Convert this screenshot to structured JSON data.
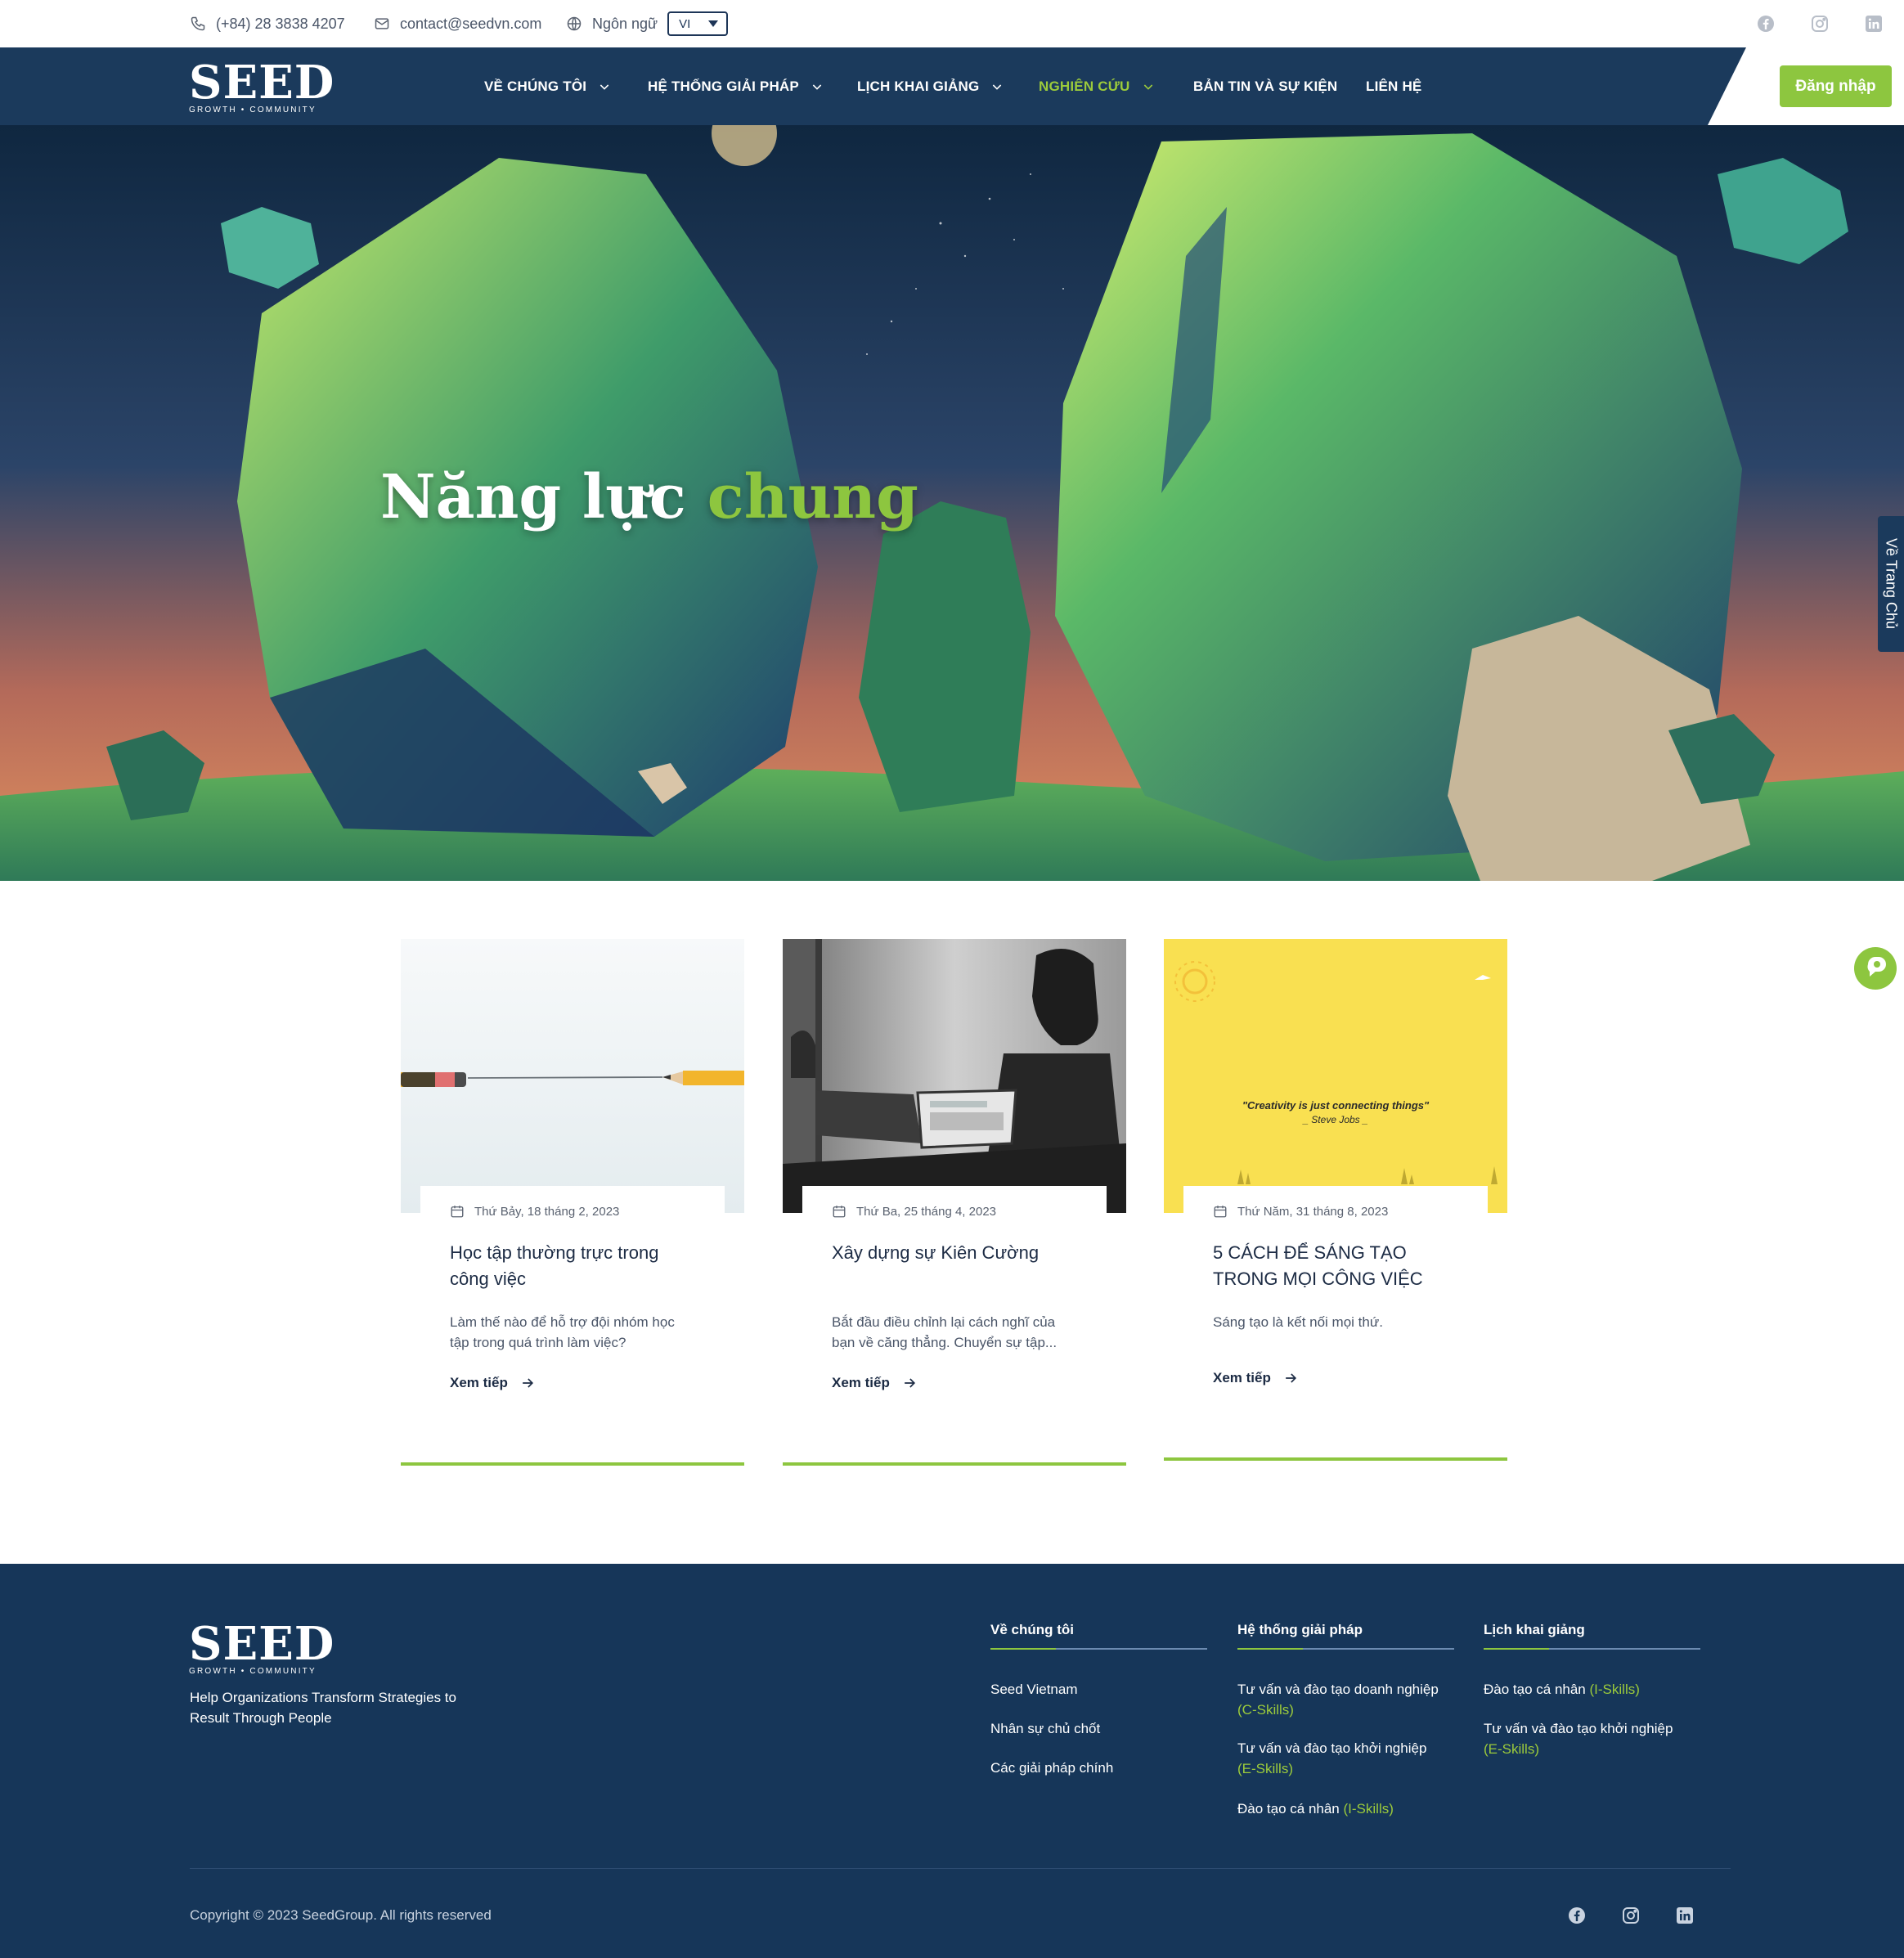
{
  "topbar": {
    "phone": "(+84) 28 3838 4207",
    "email": "contact@seedvn.com",
    "language_label": "Ngôn ngữ",
    "language_value": "VI",
    "social": [
      "facebook-icon",
      "instagram-icon",
      "linkedin-icon"
    ]
  },
  "brand": {
    "name": "SEED",
    "tagline": "GROWTH • COMMUNITY"
  },
  "nav": {
    "items": [
      {
        "label": "VỀ CHÚNG TÔI",
        "has_dropdown": true
      },
      {
        "label": "HỆ THỐNG GIẢI PHÁP",
        "has_dropdown": true
      },
      {
        "label": "LỊCH KHAI GIẢNG",
        "has_dropdown": true
      },
      {
        "label": "NGHIÊN CỨU",
        "has_dropdown": true,
        "active": true
      },
      {
        "label": "BẢN TIN VÀ SỰ KIỆN",
        "has_dropdown": false
      },
      {
        "label": "LIÊN HỆ",
        "has_dropdown": false
      }
    ],
    "login_label": "Đăng nhập"
  },
  "hero": {
    "title_part1": "Năng lực",
    "title_part2": "chung",
    "side_tab": "Về Trang Chủ"
  },
  "articles": [
    {
      "date": "Thứ Bảy, 18 tháng 2, 2023",
      "title": "Học tập thường trực trong công việc",
      "excerpt": "Làm thế nào để hỗ trợ đội nhóm học tập trong quá trình làm việc?",
      "read_more": "Xem tiếp"
    },
    {
      "date": "Thứ Ba, 25 tháng 4, 2023",
      "title": "Xây dựng sự Kiên Cường",
      "excerpt": "Bắt đầu điều chỉnh lại cách nghĩ của bạn về căng thẳng. Chuyển sự tập...",
      "read_more": "Xem tiếp"
    },
    {
      "date": "Thứ Năm, 31 tháng 8, 2023",
      "title": "5 CÁCH ĐỂ SÁNG TẠO TRONG MỌI CÔNG VIỆC",
      "excerpt": "Sáng tạo là kết nối mọi thứ.",
      "read_more": "Xem tiếp",
      "image_quote": "\"Creativity is just connecting things\"",
      "image_quote_author": "_ Steve Jobs _"
    }
  ],
  "footer": {
    "tagline": "Help Organizations Transform Strategies to Result Through People",
    "columns": [
      {
        "heading": "Về chúng tôi",
        "links": [
          {
            "text": "Seed Vietnam",
            "tag": ""
          },
          {
            "text": "Nhân sự chủ chốt",
            "tag": ""
          },
          {
            "text": "Các giải pháp chính",
            "tag": ""
          }
        ]
      },
      {
        "heading": "Hệ thống giải pháp",
        "links": [
          {
            "text": "Tư vấn và đào tạo doanh nghiệp",
            "tag": "(C-Skills)"
          },
          {
            "text": "Tư vấn và đào tạo khởi nghiệp",
            "tag": "(E-Skills)"
          },
          {
            "text": "Đào tạo cá nhân",
            "tag": "(I-Skills)"
          }
        ]
      },
      {
        "heading": "Lịch khai giảng",
        "links": [
          {
            "text": "Đào tạo cá nhân",
            "tag": "(I-Skills)"
          },
          {
            "text": "Tư vấn và đào tạo khởi nghiệp",
            "tag": "(E-Skills)"
          }
        ]
      }
    ],
    "copyright": "Copyright © 2023 SeedGroup. All rights reserved"
  },
  "colors": {
    "navy": "#1b3a5c",
    "footer_navy": "#163659",
    "accent_green": "#8dc63f"
  }
}
